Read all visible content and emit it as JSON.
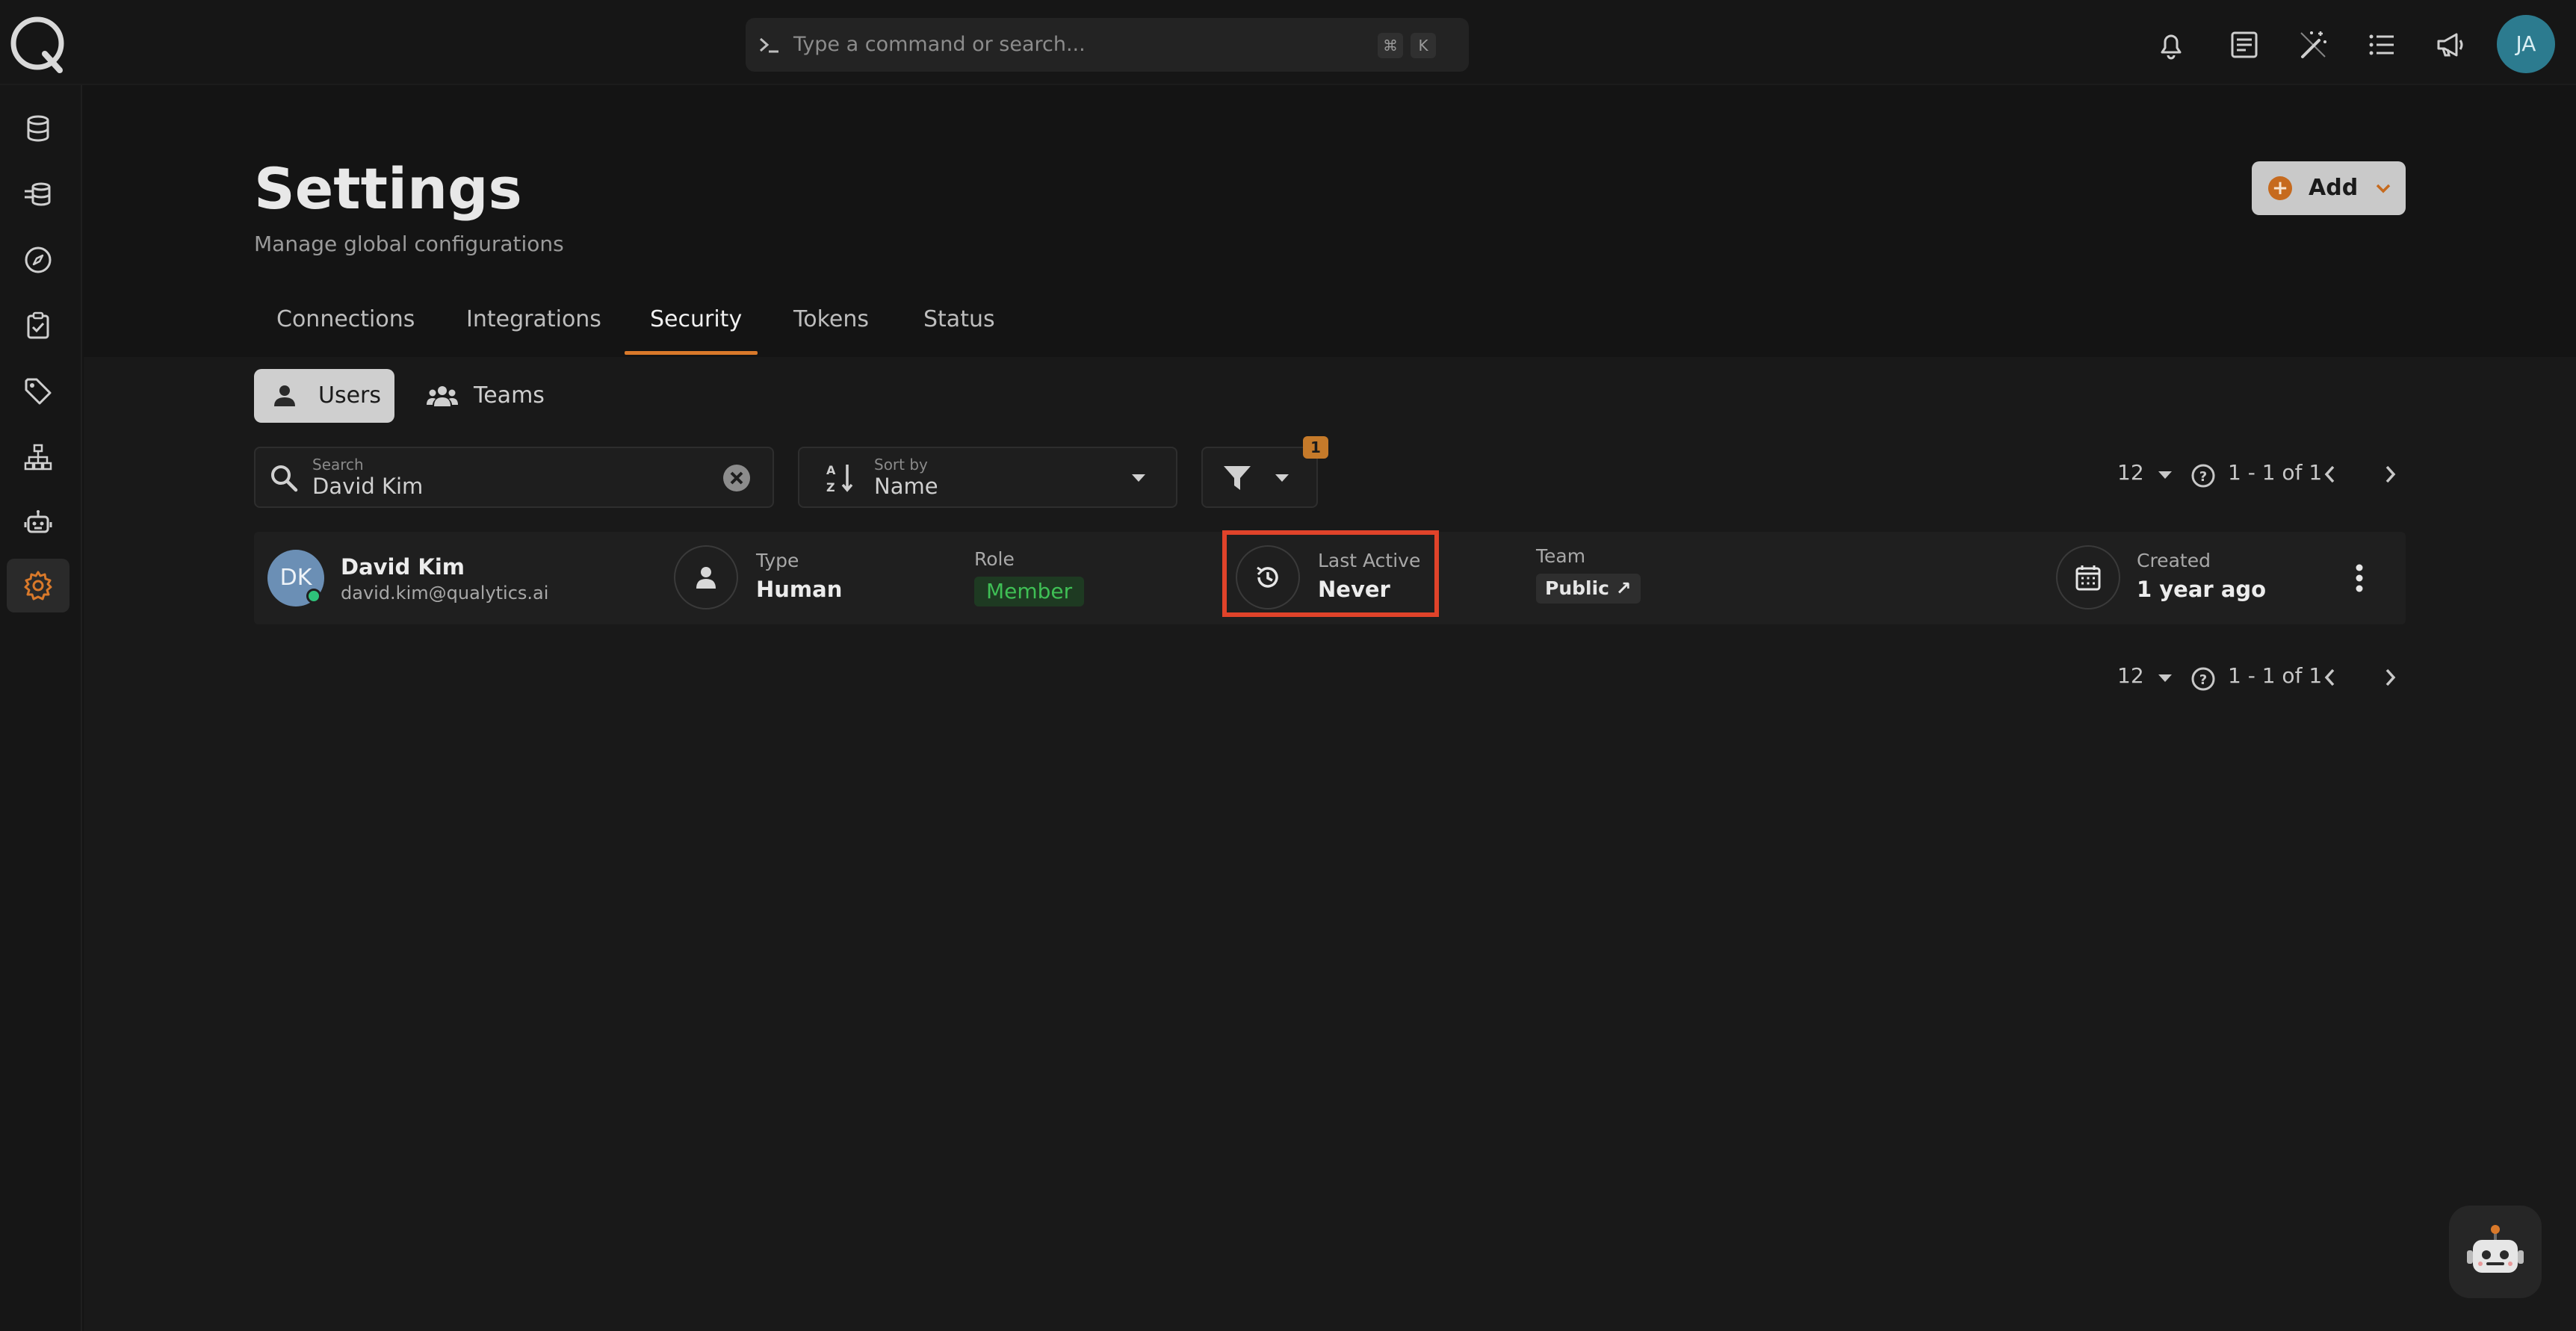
{
  "topbar": {
    "command_placeholder": "Type a command or search...",
    "shortcut_mod": "⌘",
    "shortcut_key": "K",
    "user_initials": "JA"
  },
  "header": {
    "title": "Settings",
    "subtitle": "Manage global configurations",
    "add_label": "Add"
  },
  "tabs": [
    {
      "label": "Connections"
    },
    {
      "label": "Integrations"
    },
    {
      "label": "Security"
    },
    {
      "label": "Tokens"
    },
    {
      "label": "Status"
    }
  ],
  "active_tab": "Security",
  "segments": {
    "users_label": "Users",
    "teams_label": "Teams"
  },
  "search": {
    "label": "Search",
    "value": "David Kim"
  },
  "sort": {
    "label": "Sort by",
    "value": "Name"
  },
  "filter": {
    "active_count": "1"
  },
  "pagination": {
    "page_size": "12",
    "range": "1 - 1 of 1"
  },
  "users": [
    {
      "initials": "DK",
      "name": "David Kim",
      "email": "david.kim@qualytics.ai",
      "type_label": "Type",
      "type_value": "Human",
      "role_label": "Role",
      "role_value": "Member",
      "last_active_label": "Last Active",
      "last_active_value": "Never",
      "team_label": "Team",
      "team_value": "Public ↗",
      "created_label": "Created",
      "created_value": "1 year ago"
    }
  ],
  "colors": {
    "accent": "#d9792a",
    "highlight": "#e0432a",
    "member_green": "#3fbf55",
    "online": "#2ec27a"
  }
}
